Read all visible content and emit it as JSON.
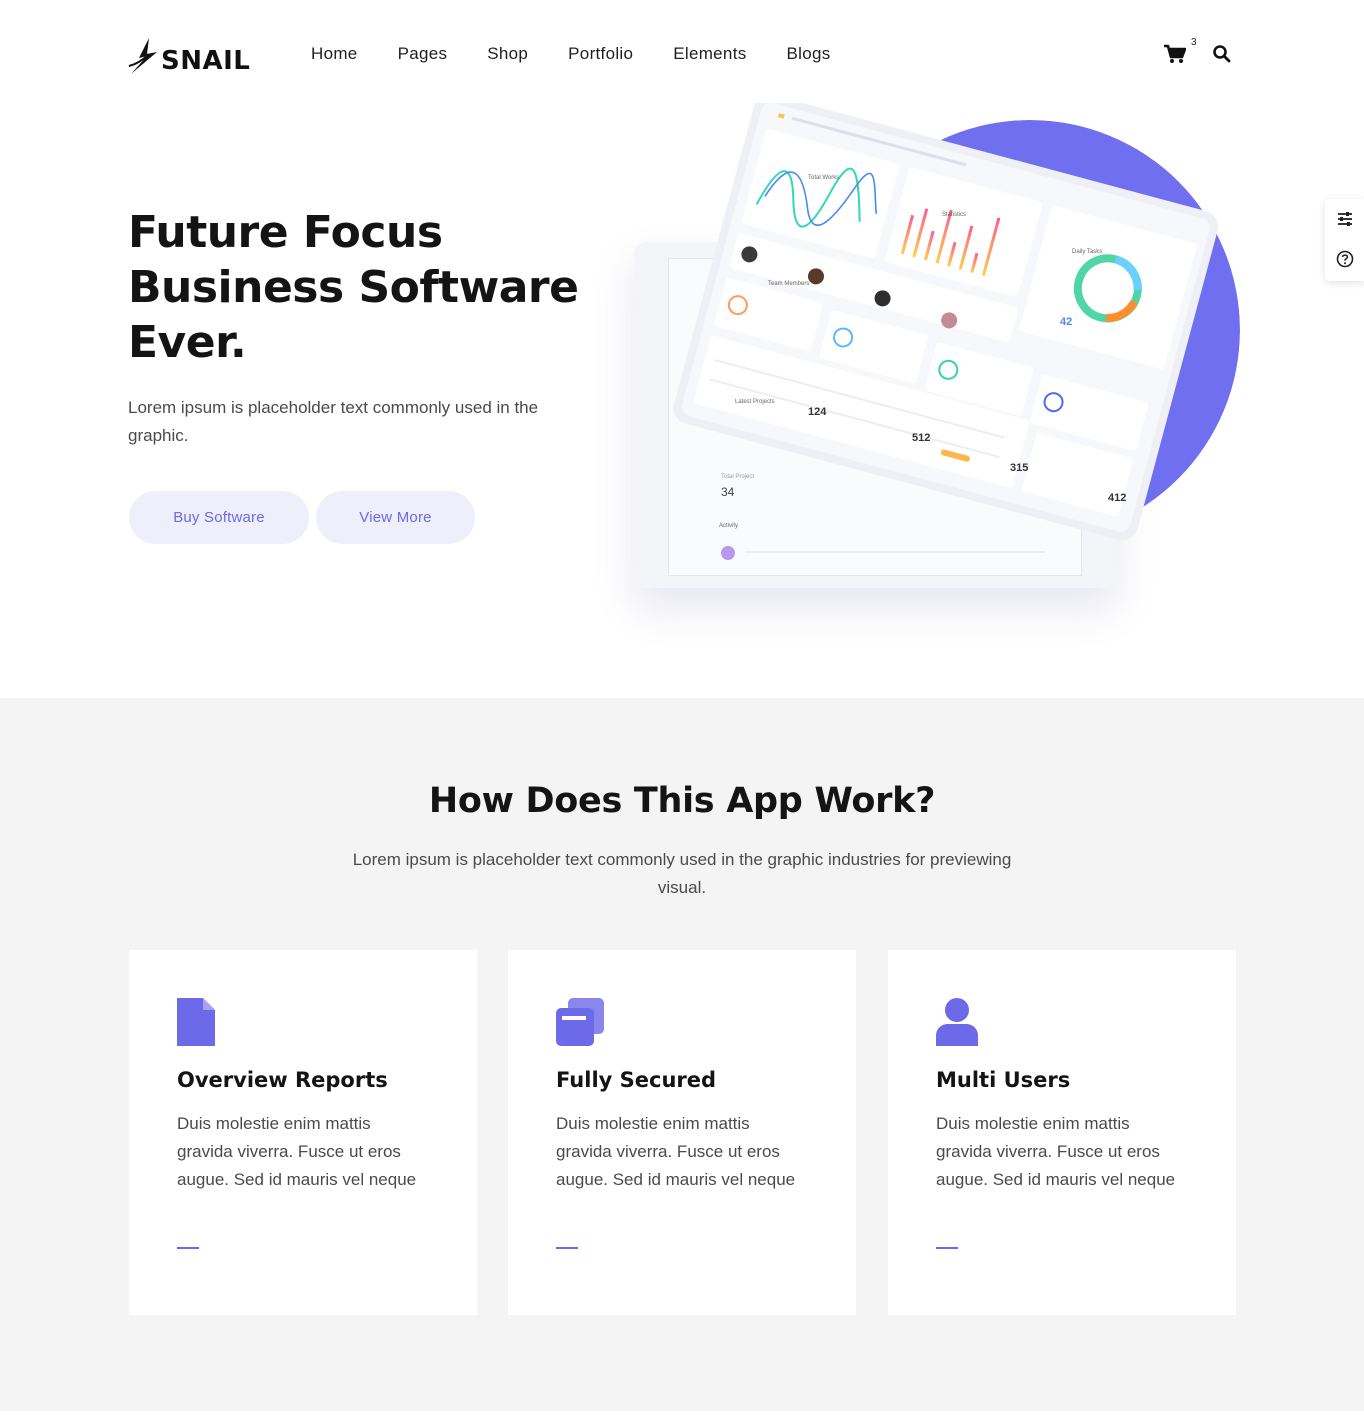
{
  "brand": {
    "name": "SNAIL"
  },
  "nav": {
    "items": [
      "Home",
      "Pages",
      "Shop",
      "Portfolio",
      "Elements",
      "Blogs"
    ]
  },
  "header": {
    "cart_count": "3",
    "cart_icon": "cart-icon",
    "search_icon": "search-icon"
  },
  "side_widget": {
    "icons": [
      "sliders-icon",
      "help-circle-icon"
    ]
  },
  "hero": {
    "title_lines": [
      "Future Focus",
      "Business Software",
      "Ever."
    ],
    "description": "Lorem ipsum is placeholder text commonly used in the graphic.",
    "buttons": {
      "primary": "Buy Software",
      "secondary": "View More"
    }
  },
  "dashboard": {
    "total_works": "Total Works",
    "statistics": "Statistics",
    "daily_tasks": "Daily Tasks",
    "daily_tasks_value": "42",
    "team_members": "Team Members",
    "works_value": "124",
    "analytics_value": "512",
    "statistics_value": "315",
    "tasks_value": "412",
    "total_project": "Total Project",
    "total_project_value": "34",
    "activity": "Activity",
    "latest_projects": "Latest Projects"
  },
  "how": {
    "title": "How Does This App Work?",
    "description": "Lorem ipsum is placeholder text commonly used in the graphic industries for previewing visual.",
    "cards": [
      {
        "icon": "document-icon",
        "title": "Overview Reports",
        "text": "Duis molestie enim mattis gravida viverra. Fusce ut eros augue. Sed id mauris vel neque"
      },
      {
        "icon": "files-icon",
        "title": "Fully Secured",
        "text": "Duis molestie enim mattis gravida viverra. Fusce ut eros augue. Sed id mauris vel neque"
      },
      {
        "icon": "user-icon",
        "title": "Multi Users",
        "text": "Duis molestie enim mattis gravida viverra. Fusce ut eros augue. Sed id mauris vel neque"
      }
    ]
  },
  "colors": {
    "accent": "#6c6ae8",
    "blob": "#6f6ff0",
    "button_bg": "#efeefb",
    "section_bg": "#f4f4f4"
  }
}
